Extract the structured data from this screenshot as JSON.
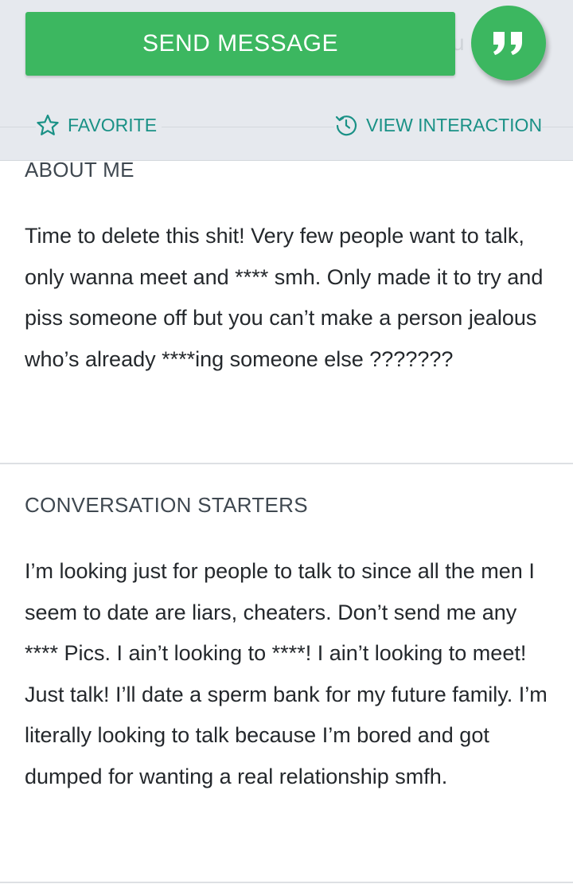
{
  "header": {
    "send_message_label": "SEND MESSAGE",
    "ghost_text": "u",
    "quote_icon": "quote-icon",
    "favorite_label": "FAVORITE",
    "favorite_icon": "star-outline-icon",
    "view_interaction_label": "VIEW INTERACTION",
    "view_interaction_icon": "history-icon"
  },
  "about": {
    "title": "ABOUT ME",
    "body": "Time to delete this shit! Very few people want to talk, only wanna meet and **** smh. Only made it to try and piss someone off but you can’t make a person jealous who’s already ****ing someone else ???????"
  },
  "starters": {
    "title": "CONVERSATION STARTERS",
    "body": "I’m looking just for people to talk to since all the men I seem to date are liars, cheaters. Don’t send me any **** Pics. I ain’t looking to ****! I ain’t looking to meet! Just talk! I’ll date a sperm bank for my future family. I’m literally looking to talk because I’m bored and got dumped for wanting a real relationship smfh."
  },
  "colors": {
    "accent_green": "#3cb760",
    "link_teal": "#1a9186",
    "header_bg": "#e6e9ee"
  }
}
